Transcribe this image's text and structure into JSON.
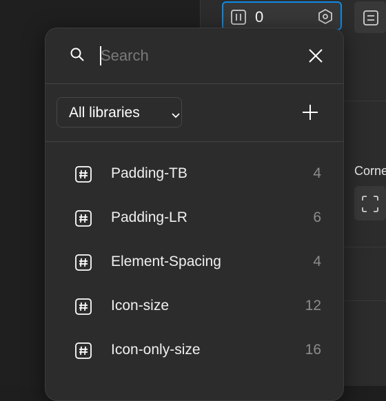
{
  "gap_field": {
    "value": "0",
    "lead_icon": "gap-icon",
    "trail_icon": "variable-hexagon-icon"
  },
  "side_panel": {
    "corner_label": "Corne",
    "align_icon": "align-icon",
    "corner_icon": "corner-radius-icon"
  },
  "popover": {
    "search": {
      "placeholder": "Search",
      "value": ""
    },
    "library_select": {
      "label": "All libraries"
    },
    "variables": [
      {
        "name": "Padding-TB",
        "count": "4"
      },
      {
        "name": "Padding-LR",
        "count": "6"
      },
      {
        "name": "Element-Spacing",
        "count": "4"
      },
      {
        "name": "Icon-size",
        "count": "12"
      },
      {
        "name": "Icon-only-size",
        "count": "16"
      }
    ]
  },
  "colors": {
    "accent": "#0c8ce9",
    "panel": "#2c2c2c",
    "background": "#1e1e1e",
    "muted_text": "#8c8c8c"
  }
}
